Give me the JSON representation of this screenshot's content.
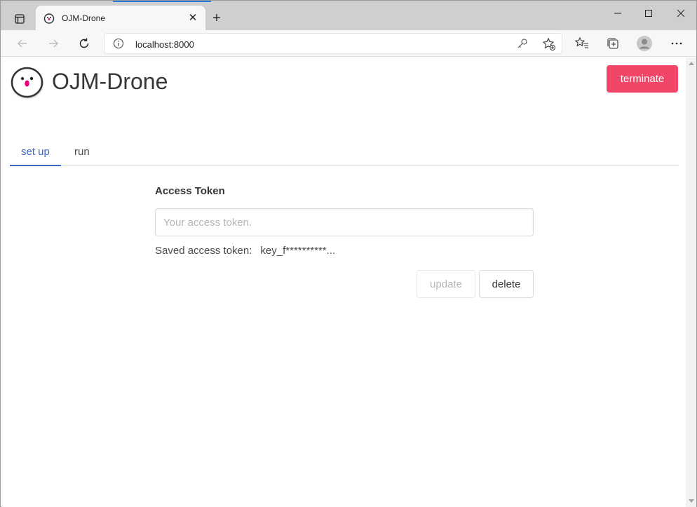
{
  "browser": {
    "tab_title": "OJM-Drone",
    "url": "localhost:8000"
  },
  "app": {
    "title": "OJM-Drone",
    "terminate_label": "terminate"
  },
  "tabs": [
    {
      "label": "set up",
      "active": true
    },
    {
      "label": "run",
      "active": false
    }
  ],
  "form": {
    "label": "Access Token",
    "input_value": "",
    "input_placeholder": "Your access token.",
    "saved_label": "Saved access token:",
    "saved_value": "key_f**********...",
    "update_label": "update",
    "delete_label": "delete"
  },
  "colors": {
    "terminate": "#f14668",
    "active_tab": "#3e68c4"
  }
}
